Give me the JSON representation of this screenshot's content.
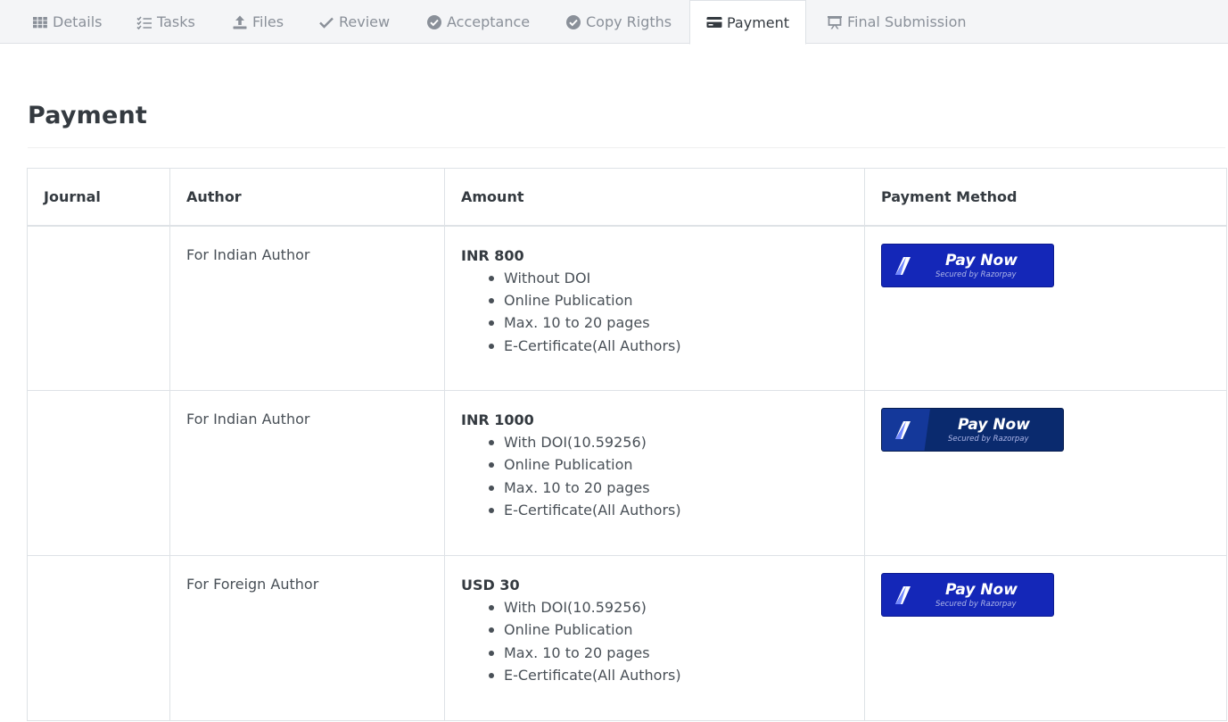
{
  "tabs": [
    {
      "label": "Details",
      "icon": "grid-icon"
    },
    {
      "label": "Tasks",
      "icon": "checklist-icon"
    },
    {
      "label": "Files",
      "icon": "upload-icon"
    },
    {
      "label": "Review",
      "icon": "check-icon"
    },
    {
      "label": "Acceptance",
      "icon": "check-circle-icon"
    },
    {
      "label": "Copy Rigths",
      "icon": "check-circle-icon"
    },
    {
      "label": "Payment",
      "icon": "credit-card-icon",
      "active": true
    },
    {
      "label": "Final Submission",
      "icon": "projector-icon"
    }
  ],
  "page": {
    "title": "Payment"
  },
  "table": {
    "headers": [
      "Journal",
      "Author",
      "Amount",
      "Payment Method"
    ],
    "rows": [
      {
        "journal": "",
        "author": "For Indian Author",
        "amount": "INR 800",
        "features": [
          "Without DOI",
          "Online Publication",
          "Max. 10 to 20 pages",
          "E-Certificate(All Authors)"
        ],
        "pay": {
          "label": "Pay Now",
          "sub": "Secured by Razorpay"
        }
      },
      {
        "journal": "",
        "author": "For Indian Author",
        "amount": "INR 1000",
        "features": [
          "With DOI(10.59256)",
          "Online Publication",
          "Max. 10 to 20 pages",
          "E-Certificate(All Authors)"
        ],
        "pay": {
          "label": "Pay Now",
          "sub": "Secured by Razorpay"
        }
      },
      {
        "journal": "",
        "author": "For Foreign Author",
        "amount": "USD 30",
        "features": [
          "With DOI(10.59256)",
          "Online Publication",
          "Max. 10 to 20 pages",
          "E-Certificate(All Authors)"
        ],
        "pay": {
          "label": "Pay Now",
          "sub": "Secured by Razorpay"
        }
      }
    ]
  },
  "colors": {
    "pay_button": "#1427b8",
    "pay_button_dark": "#0a2a6e",
    "tabbar": "#f4f5f7"
  }
}
